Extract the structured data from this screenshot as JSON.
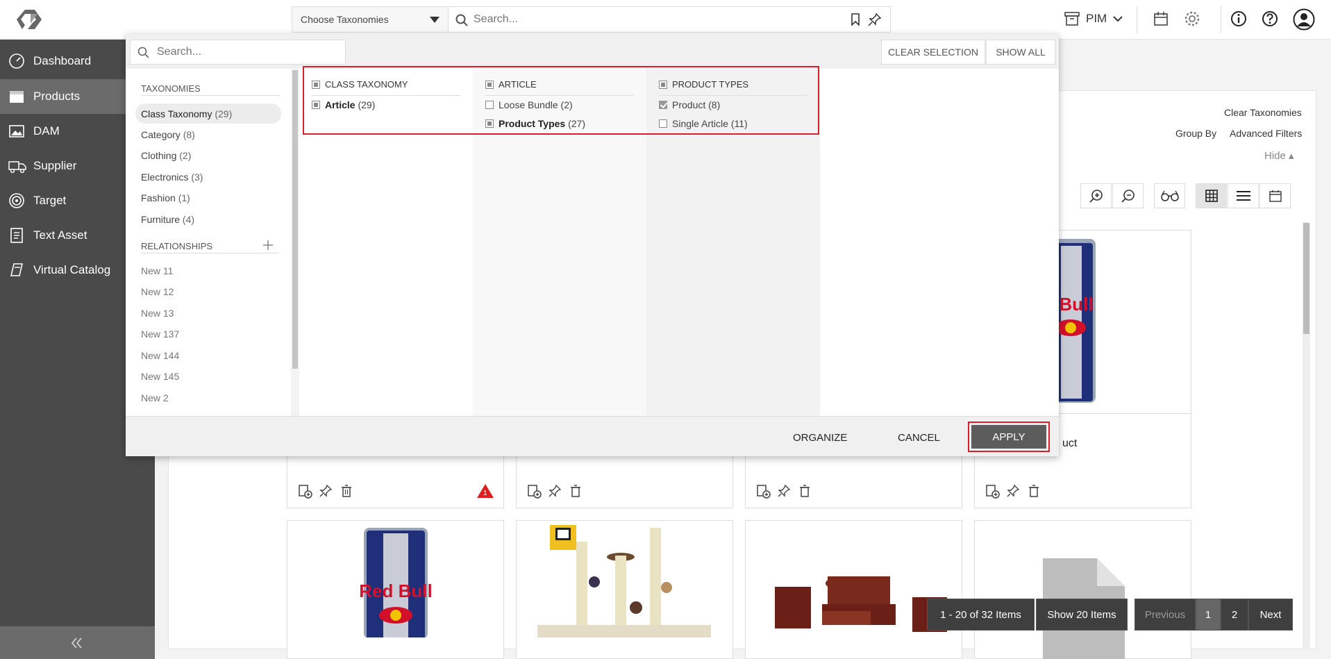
{
  "topbar": {
    "taxonomy_select": "Choose Taxonomies",
    "search_placeholder": "Search...",
    "module": "PIM"
  },
  "sidebar": {
    "items": [
      {
        "label": "Dashboard",
        "icon": "dashboard-icon"
      },
      {
        "label": "Products",
        "icon": "products-icon"
      },
      {
        "label": "DAM",
        "icon": "image-icon"
      },
      {
        "label": "Supplier",
        "icon": "truck-icon"
      },
      {
        "label": "Target",
        "icon": "target-icon"
      },
      {
        "label": "Text Asset",
        "icon": "document-icon"
      },
      {
        "label": "Virtual Catalog",
        "icon": "catalog-icon"
      }
    ],
    "collapse_icon": "double-chevron-left-icon"
  },
  "panel": {
    "search_placeholder": "Search...",
    "clear_selection": "CLEAR SELECTION",
    "show_all": "SHOW ALL",
    "taxonomies_heading": "TAXONOMIES",
    "taxonomies": [
      {
        "name": "Class Taxonomy",
        "count": "(29)"
      },
      {
        "name": "Category",
        "count": "(8)"
      },
      {
        "name": "Clothing",
        "count": "(2)"
      },
      {
        "name": "Electronics",
        "count": "(3)"
      },
      {
        "name": "Fashion",
        "count": "(1)"
      },
      {
        "name": "Furniture",
        "count": "(4)"
      }
    ],
    "relationships_heading": "RELATIONSHIPS",
    "relationships": [
      "New 11",
      "New 12",
      "New 13",
      "New 137",
      "New 144",
      "New 145",
      "New 2"
    ],
    "columns": [
      {
        "heading": "CLASS TAXONOMY",
        "options": [
          {
            "name": "Article",
            "count": "(29)",
            "bold": true,
            "state": "partial"
          }
        ]
      },
      {
        "heading": "ARTICLE",
        "options": [
          {
            "name": "Loose Bundle",
            "count": "(2)",
            "bold": false,
            "state": "unchecked"
          },
          {
            "name": "Product Types",
            "count": "(27)",
            "bold": true,
            "state": "partial"
          }
        ]
      },
      {
        "heading": "PRODUCT TYPES",
        "options": [
          {
            "name": "Product",
            "count": "(8)",
            "bold": false,
            "state": "checked"
          },
          {
            "name": "Single Article",
            "count": "(11)",
            "bold": false,
            "state": "unchecked"
          }
        ]
      }
    ],
    "organize": "ORGANIZE",
    "cancel": "CANCEL",
    "apply": "APPLY"
  },
  "right_panel": {
    "clear_taxonomies": "Clear Taxonomies",
    "group_by": "Group By",
    "advanced_filters": "Advanced Filters",
    "hide": "Hide ▴"
  },
  "card_partial_title": "uct",
  "warning_badge": "1",
  "pagination": {
    "range": "1 - 20 of 32 Items",
    "show": "Show 20 Items",
    "previous": "Previous",
    "pages": [
      "1",
      "2"
    ],
    "next": "Next"
  }
}
